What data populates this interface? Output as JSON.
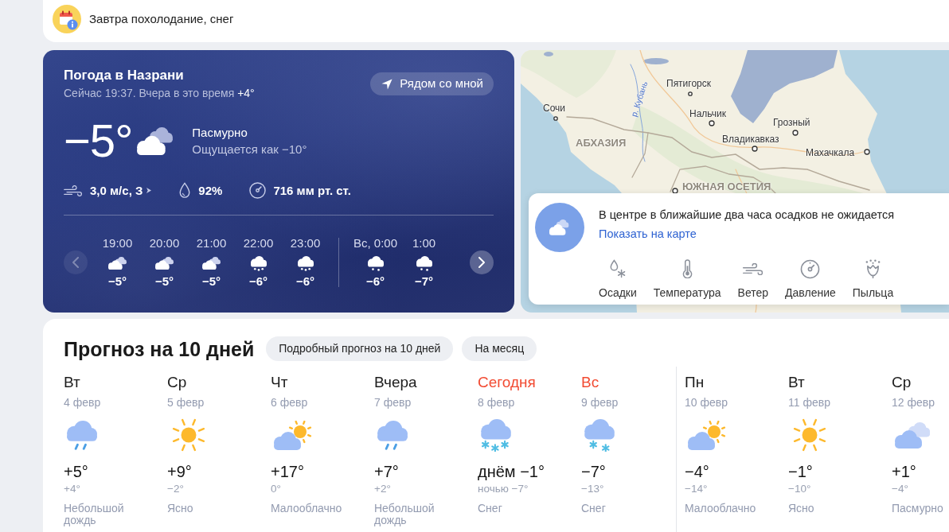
{
  "notification": {
    "text": "Завтра похолодание, снег"
  },
  "current": {
    "title": "Погода в Назрани",
    "now_text": "Сейчас 19:37. Вчера в это время",
    "yesterday_temp": "+4°",
    "nearby_button": "Рядом со мной",
    "temperature": "−5°",
    "condition": "Пасмурно",
    "feels_like": "Ощущается как −10°",
    "wind": "3,0 м/с, З",
    "humidity": "92%",
    "pressure": "716 мм рт. ст.",
    "prev_button": {
      "disabled": true
    },
    "next_button": {
      "disabled": false
    },
    "hourly": [
      {
        "time": "19:00",
        "temp": "−5°",
        "kind": "cloudy",
        "new_day": false
      },
      {
        "time": "20:00",
        "temp": "−5°",
        "kind": "cloudy",
        "new_day": false
      },
      {
        "time": "21:00",
        "temp": "−5°",
        "kind": "cloudy",
        "new_day": false
      },
      {
        "time": "22:00",
        "temp": "−6°",
        "kind": "snow",
        "new_day": false
      },
      {
        "time": "23:00",
        "temp": "−6°",
        "kind": "snow",
        "new_day": false
      },
      {
        "time": "Вс, 0:00",
        "temp": "−6°",
        "kind": "light_snow",
        "new_day": true
      },
      {
        "time": "1:00",
        "temp": "−7°",
        "kind": "light_snow",
        "new_day": false
      }
    ]
  },
  "map": {
    "labels": [
      {
        "text": "Пятигорск",
        "kind": "city"
      },
      {
        "text": "р. Кубань",
        "kind": "river"
      },
      {
        "text": "Сочи",
        "kind": "city"
      },
      {
        "text": "Нальчик",
        "kind": "city"
      },
      {
        "text": "Грозный",
        "kind": "city"
      },
      {
        "text": "Владикавказ",
        "kind": "city"
      },
      {
        "text": "АБХАЗИЯ",
        "kind": "region"
      },
      {
        "text": "Махачкала",
        "kind": "city"
      },
      {
        "text": "ЮЖНАЯ ОСЕТИЯ",
        "kind": "region"
      }
    ]
  },
  "precipitation": {
    "message": "В центре в ближайшие два часа осадков не ожидается",
    "link": "Показать на карте",
    "layers": [
      {
        "label": "Осадки",
        "kind": "precipitation"
      },
      {
        "label": "Температура",
        "kind": "temperature"
      },
      {
        "label": "Ветер",
        "kind": "wind"
      },
      {
        "label": "Давление",
        "kind": "pressure"
      },
      {
        "label": "Пыльца",
        "kind": "pollen"
      }
    ]
  },
  "forecast": {
    "title": "Прогноз на 10 дней",
    "buttons": [
      "Подробный прогноз на 10 дней",
      "На месяц"
    ],
    "days": [
      {
        "day": "Вт",
        "date": "4 февр",
        "max": "+5°",
        "min": "+4°",
        "condition": "Небольшой дождь",
        "kind": "rain",
        "weekend": false,
        "new_week": false
      },
      {
        "day": "Ср",
        "date": "5 февр",
        "max": "+9°",
        "min": "−2°",
        "condition": "Ясно",
        "kind": "clear",
        "weekend": false,
        "new_week": false
      },
      {
        "day": "Чт",
        "date": "6 февр",
        "max": "+17°",
        "min": "0°",
        "condition": "Малооблачно",
        "kind": "partly_cloudy",
        "weekend": false,
        "new_week": false
      },
      {
        "day": "Вчера",
        "date": "7 февр",
        "max": "+7°",
        "min": "+2°",
        "condition": "Небольшой дождь",
        "kind": "rain",
        "weekend": false,
        "new_week": false
      },
      {
        "day": "Сегодня",
        "date": "8 февр",
        "max": "днём −1°",
        "min": "ночью −7°",
        "condition": "Снег",
        "kind": "snow",
        "weekend": true,
        "new_week": false
      },
      {
        "day": "Вс",
        "date": "9 февр",
        "max": "−7°",
        "min": "−13°",
        "condition": "Снег",
        "kind": "light_snow",
        "weekend": true,
        "new_week": false
      },
      {
        "day": "Пн",
        "date": "10 февр",
        "max": "−4°",
        "min": "−14°",
        "condition": "Малооблачно",
        "kind": "partly_cloudy",
        "weekend": false,
        "new_week": true
      },
      {
        "day": "Вт",
        "date": "11 февр",
        "max": "−1°",
        "min": "−10°",
        "condition": "Ясно",
        "kind": "clear",
        "weekend": false,
        "new_week": false
      },
      {
        "day": "Ср",
        "date": "12 февр",
        "max": "+1°",
        "min": "−4°",
        "condition": "Пасмурно",
        "kind": "overcast",
        "weekend": false,
        "new_week": false
      }
    ]
  }
}
